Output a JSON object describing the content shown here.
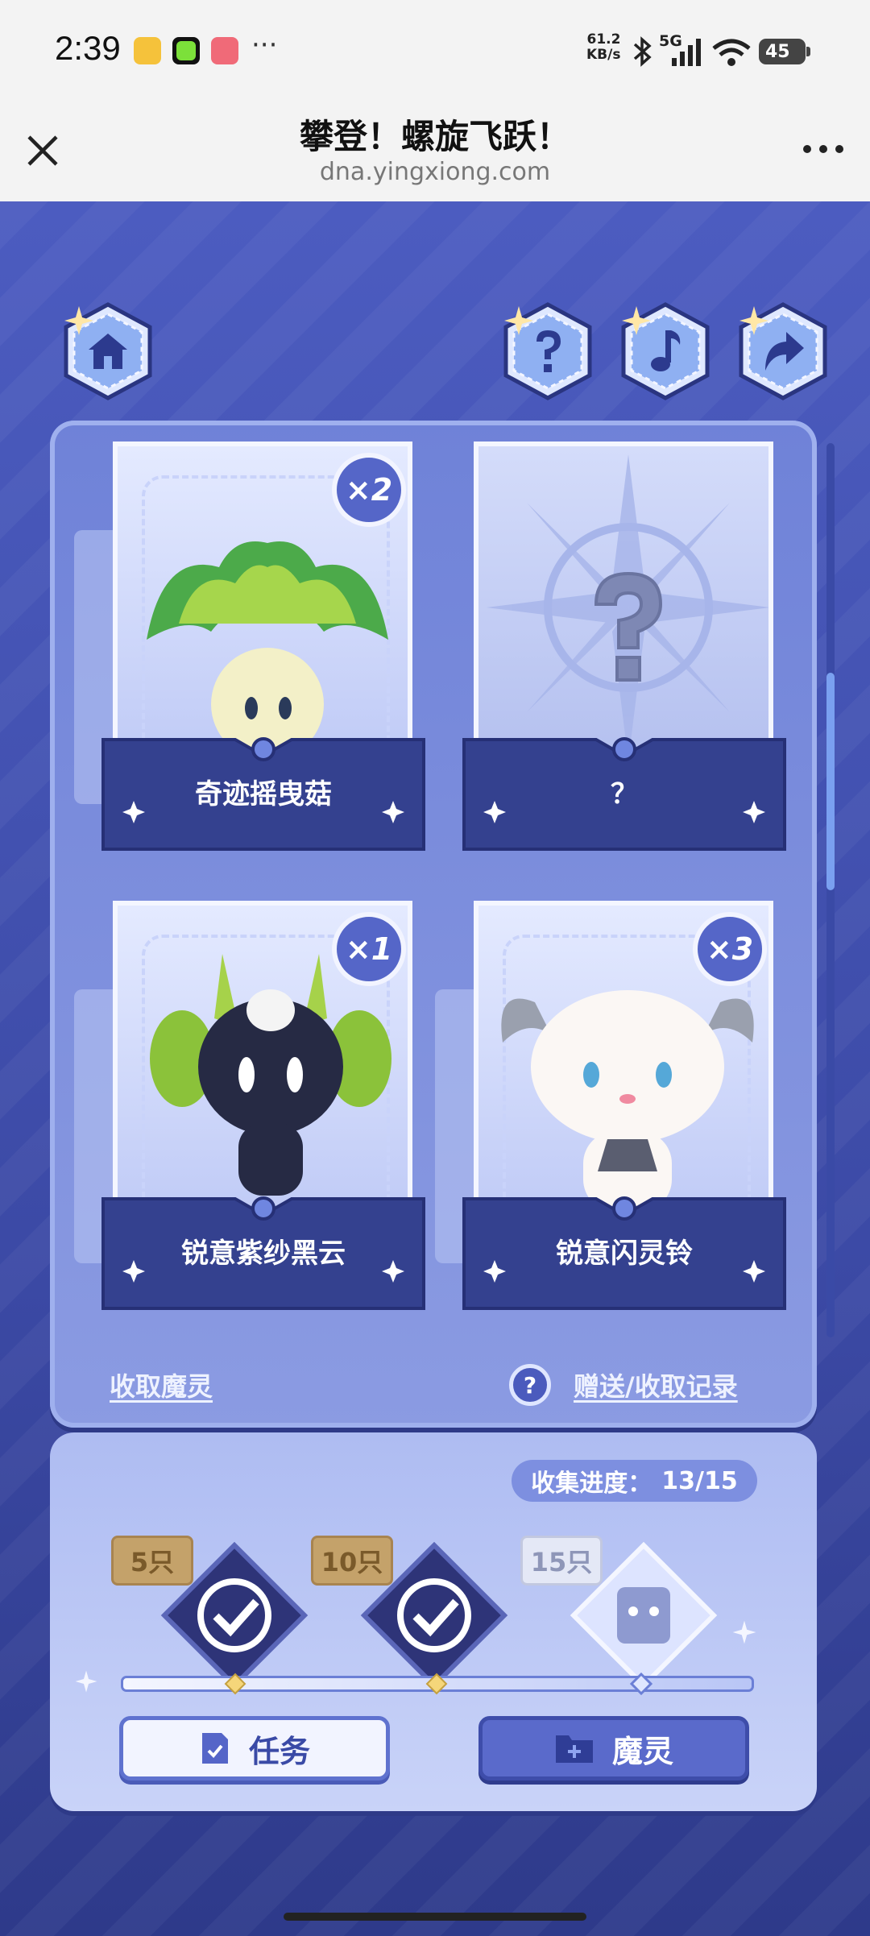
{
  "status_bar": {
    "time": "2:39",
    "net_speed_value": "61.2",
    "net_speed_unit": "KB/s",
    "network": "5G",
    "battery": "45",
    "overflow": "···"
  },
  "titlebar": {
    "title": "攀登！螺旋飞跃！",
    "url": "dna.yingxiong.com"
  },
  "toolbar": {
    "icons": [
      "home-icon",
      "help-icon",
      "music-icon",
      "share-icon"
    ]
  },
  "cards": [
    {
      "name": "奇迹摇曳菇",
      "count": "×2",
      "unknown": false
    },
    {
      "name": "？",
      "count": "",
      "unknown": true
    },
    {
      "name": "锐意紫纱黑云",
      "count": "×1",
      "unknown": false
    },
    {
      "name": "锐意闪灵铃",
      "count": "×3",
      "unknown": false
    }
  ],
  "links": {
    "collect": "收取魔灵",
    "records": "赠送/收取记录",
    "help": "?"
  },
  "collection": {
    "label": "收集进度：",
    "value": "13/15",
    "milestones": [
      {
        "label": "5只",
        "completed": true
      },
      {
        "label": "10只",
        "completed": true
      },
      {
        "label": "15只",
        "completed": false
      }
    ]
  },
  "buttons": {
    "tasks": "任务",
    "spirits": "魔灵"
  },
  "colors": {
    "background": "#3a4aa8",
    "panel": "#7a8cdc",
    "plate": "#34418f",
    "accent": "#f0c060"
  }
}
